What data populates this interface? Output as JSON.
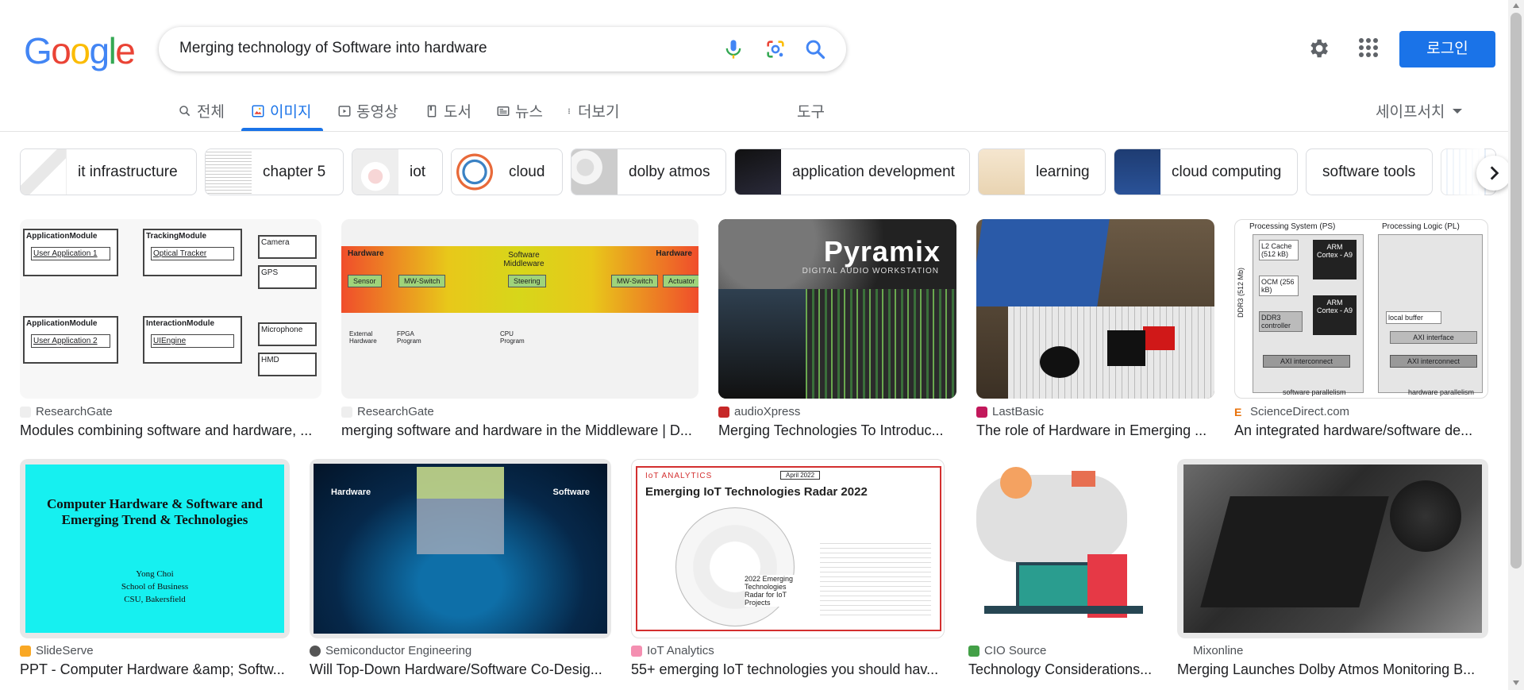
{
  "logo": {
    "g1": "G",
    "o1": "o",
    "o2": "o",
    "g2": "g",
    "l": "l",
    "e": "e"
  },
  "search": {
    "query": "Merging technology of Software into hardware"
  },
  "header": {
    "login_label": "로그인"
  },
  "tabs": [
    {
      "label": "전체",
      "icon": "search-icon"
    },
    {
      "label": "이미지",
      "icon": "image-icon",
      "active": true
    },
    {
      "label": "동영상",
      "icon": "video-icon"
    },
    {
      "label": "도서",
      "icon": "book-icon"
    },
    {
      "label": "뉴스",
      "icon": "news-icon"
    },
    {
      "label": "더보기",
      "icon": "more-vert-icon"
    }
  ],
  "tools_label": "도구",
  "safesearch_label": "세이프서치",
  "chips": [
    {
      "label": "it infrastructure"
    },
    {
      "label": "chapter 5"
    },
    {
      "label": "iot"
    },
    {
      "label": "cloud"
    },
    {
      "label": "dolby atmos"
    },
    {
      "label": "application development"
    },
    {
      "label": "learning"
    },
    {
      "label": "cloud computing"
    },
    {
      "label": "software tools"
    }
  ],
  "results": [
    {
      "source": "ResearchGate",
      "title": "Modules combining software and hardware, ..."
    },
    {
      "source": "ResearchGate",
      "title": "merging software and hardware in the Middleware | D..."
    },
    {
      "source": "audioXpress",
      "title": "Merging Technologies To Introduc..."
    },
    {
      "source": "LastBasic",
      "title": "The role of Hardware in Emerging ..."
    },
    {
      "source": "ScienceDirect.com",
      "title": "An integrated hardware/software de..."
    },
    {
      "source": "SlideServe",
      "title": "PPT - Computer Hardware &amp; Softw..."
    },
    {
      "source": "Semiconductor Engineering",
      "title": "Will Top-Down Hardware/Software Co-Desig..."
    },
    {
      "source": "IoT Analytics",
      "title": "55+ emerging IoT technologies you should hav..."
    },
    {
      "source": "CIO Source",
      "title": "Technology Considerations..."
    },
    {
      "source": "Mixonline",
      "title": "Merging Launches Dolby Atmos Monitoring B..."
    }
  ],
  "image_text": {
    "diag1": {
      "a1": "ApplicationModule",
      "a1b": "User Application 1",
      "t1": "TrackingModule",
      "t1b": "Optical Tracker",
      "a2": "ApplicationModule",
      "a2b": "User Application 2",
      "i1": "InteractionModule",
      "i1b": "UIEngine",
      "camera": "Camera",
      "gps": "GPS",
      "mic": "Microphone",
      "hmd": "HMD"
    },
    "middleware": {
      "hw_left": "Hardware",
      "mid": "Software Middleware",
      "hw_right": "Hardware",
      "sensor": "Sensor",
      "mw1": "MW-Switch",
      "steering": "Steering",
      "mw2": "MW-Switch",
      "actuator": "Actuator",
      "ext": "External Hardware",
      "fpga": "FPGA Program",
      "cpu": "CPU Program"
    },
    "pyramix": {
      "title": "Pyramix",
      "sub": "DIGITAL AUDIO WORKSTATION"
    },
    "ps_pl": {
      "ps": "Processing System (PS)",
      "pl": "Processing Logic (PL)",
      "l2": "L2 Cache (512 kB)",
      "ocm": "OCM (256 kB)",
      "arm": "ARM Cortex - A9",
      "ddr3c": "DDR3 controller",
      "ddr3": "DDR3 (512 Mb)",
      "local": "local buffer",
      "axi_if": "AXI interface",
      "axi": "AXI interconnect",
      "sw_par": "software parallelism",
      "hw_par": "hardware parallelism"
    },
    "slide": {
      "title": "Computer Hardware & Software and Emerging Trend & Technologies",
      "author": "Yong Choi",
      "dept": "School of Business",
      "uni": "CSU, Bakersfield"
    },
    "semi": {
      "hw": "Hardware",
      "sw": "Software"
    },
    "iot": {
      "brand": "IoT ANALYTICS",
      "date": "April 2022",
      "title": "Emerging IoT Technologies Radar 2022",
      "center": "2022 Emerging Technologies Radar for IoT Projects"
    }
  },
  "colors": {
    "accent": "#1a73e8",
    "login_bg": "#1a73e8"
  }
}
